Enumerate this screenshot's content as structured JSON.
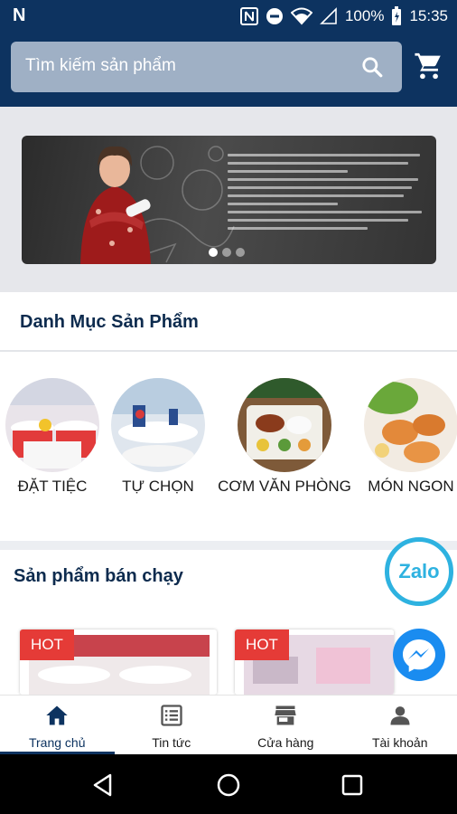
{
  "status_bar": {
    "left_glyph": "N",
    "battery": "100%",
    "time": "15:35",
    "icons": [
      "nfc-icon",
      "do-not-disturb-icon",
      "wifi-icon",
      "signal-icon",
      "battery-icon"
    ]
  },
  "header": {
    "search_placeholder": "Tìm kiếm sản phẩm",
    "icons": [
      "search-icon",
      "cart-icon"
    ]
  },
  "banner": {
    "slide_count": 3,
    "active_slide": 1
  },
  "categories": {
    "title": "Danh Mục Sản Phẩm",
    "items": [
      {
        "label": "ĐẶT TIỆC"
      },
      {
        "label": "TỰ CHỌN"
      },
      {
        "label": "CƠM VĂN PHÒNG"
      },
      {
        "label": "MÓN NGON"
      }
    ]
  },
  "best_sellers": {
    "title": "Sản phẩm bán chạy",
    "products": [
      {
        "badge": "HOT"
      },
      {
        "badge": "HOT"
      }
    ]
  },
  "floating": {
    "zalo_label": "Zalo"
  },
  "bottom_nav": {
    "items": [
      {
        "label": "Trang chủ",
        "icon": "home-icon",
        "active": true
      },
      {
        "label": "Tin tức",
        "icon": "news-icon",
        "active": false
      },
      {
        "label": "Cửa hàng",
        "icon": "store-icon",
        "active": false
      },
      {
        "label": "Tài khoản",
        "icon": "account-icon",
        "active": false
      }
    ]
  },
  "colors": {
    "primary": "#0d3360",
    "hot_badge": "#e53b37",
    "zalo": "#2eb2e0",
    "messenger": "#1a8cf0"
  }
}
